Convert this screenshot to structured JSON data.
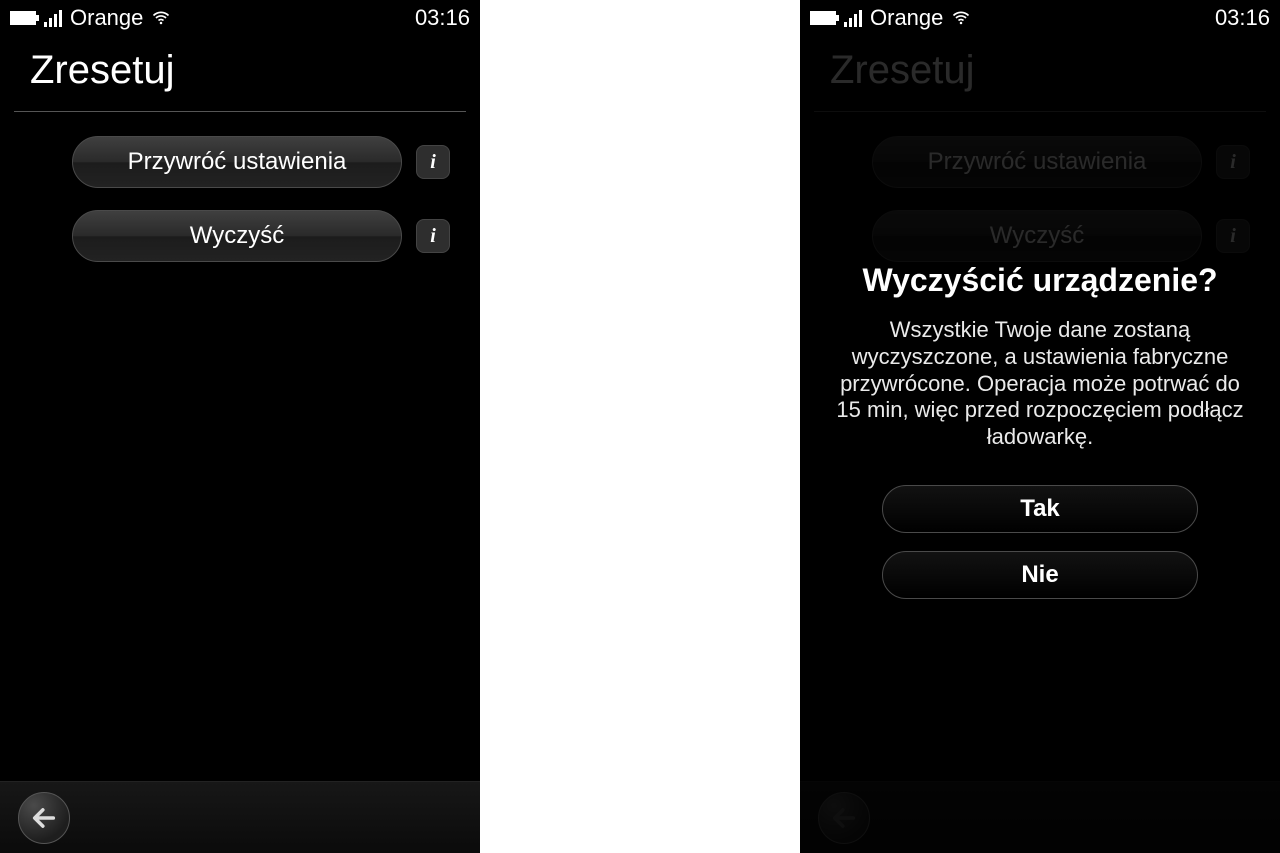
{
  "statusbar": {
    "carrier": "Orange",
    "time": "03:16"
  },
  "page_title": "Zresetuj",
  "options": {
    "restore_label": "Przywróć ustawienia",
    "clear_label": "Wyczyść",
    "info_glyph": "i"
  },
  "dialog": {
    "title": "Wyczyścić urządzenie?",
    "body": "Wszystkie Twoje dane zostaną wyczyszczone, a ustawienia fabryczne przywrócone. Operacja może potrwać do 15 min, więc przed rozpoczęciem podłącz ładowarkę.",
    "yes_label": "Tak",
    "no_label": "Nie"
  }
}
